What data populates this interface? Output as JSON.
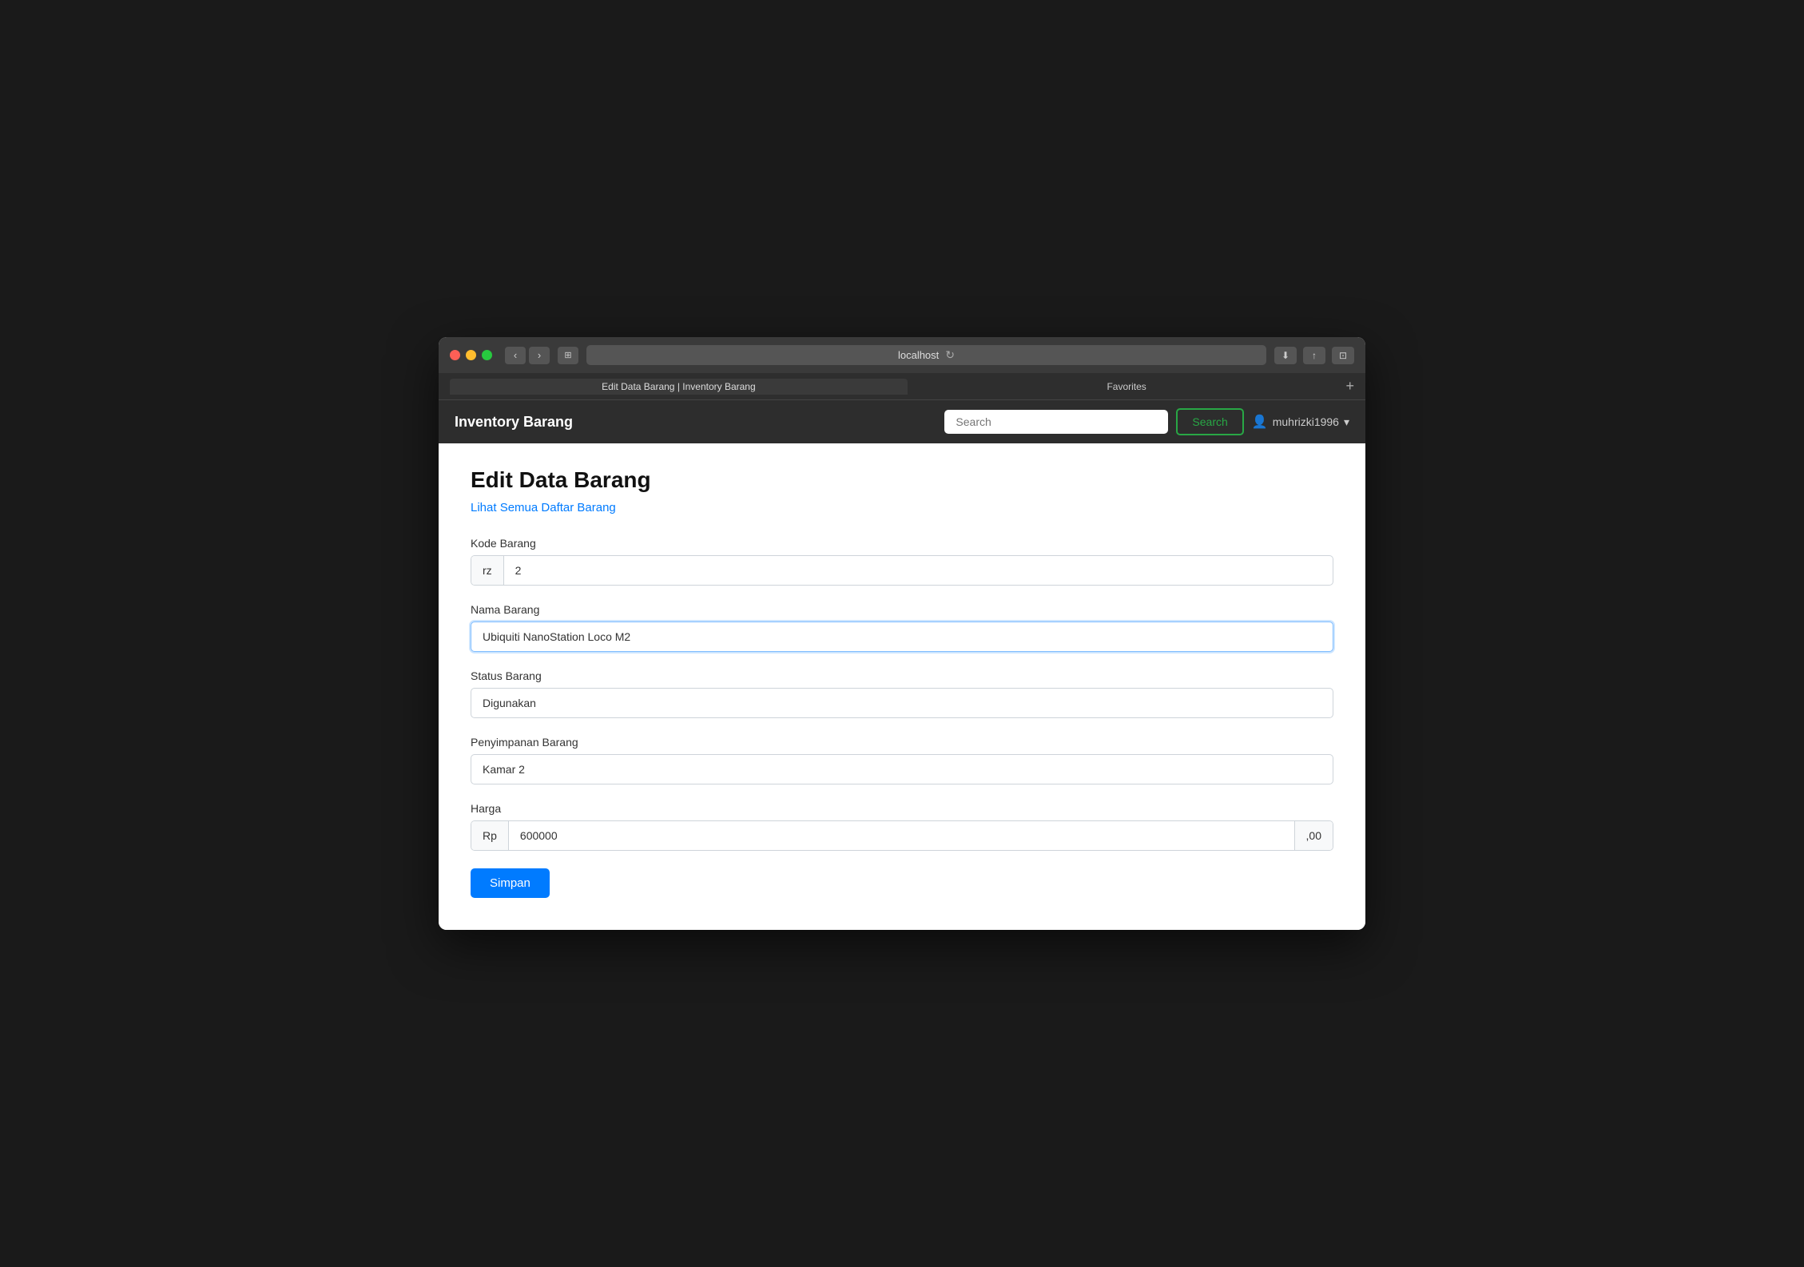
{
  "browser": {
    "url": "localhost",
    "tab_label": "Edit Data Barang | Inventory Barang",
    "favorites_label": "Favorites"
  },
  "navbar": {
    "brand": "Inventory Barang",
    "search_placeholder": "Search",
    "search_button": "Search",
    "username": "muhrizki1996"
  },
  "page": {
    "title": "Edit Data Barang",
    "back_link": "Lihat Semua Daftar Barang",
    "fields": {
      "kode_barang": {
        "label": "Kode Barang",
        "prefix": "rz",
        "value": "2"
      },
      "nama_barang": {
        "label": "Nama Barang",
        "value": "Ubiquiti NanoStation Loco M2"
      },
      "status_barang": {
        "label": "Status Barang",
        "value": "Digunakan"
      },
      "penyimpanan_barang": {
        "label": "Penyimpanan Barang",
        "value": "Kamar 2"
      },
      "harga": {
        "label": "Harga",
        "prefix": "Rp",
        "value": "600000",
        "suffix": ",00"
      }
    },
    "save_button": "Simpan"
  }
}
